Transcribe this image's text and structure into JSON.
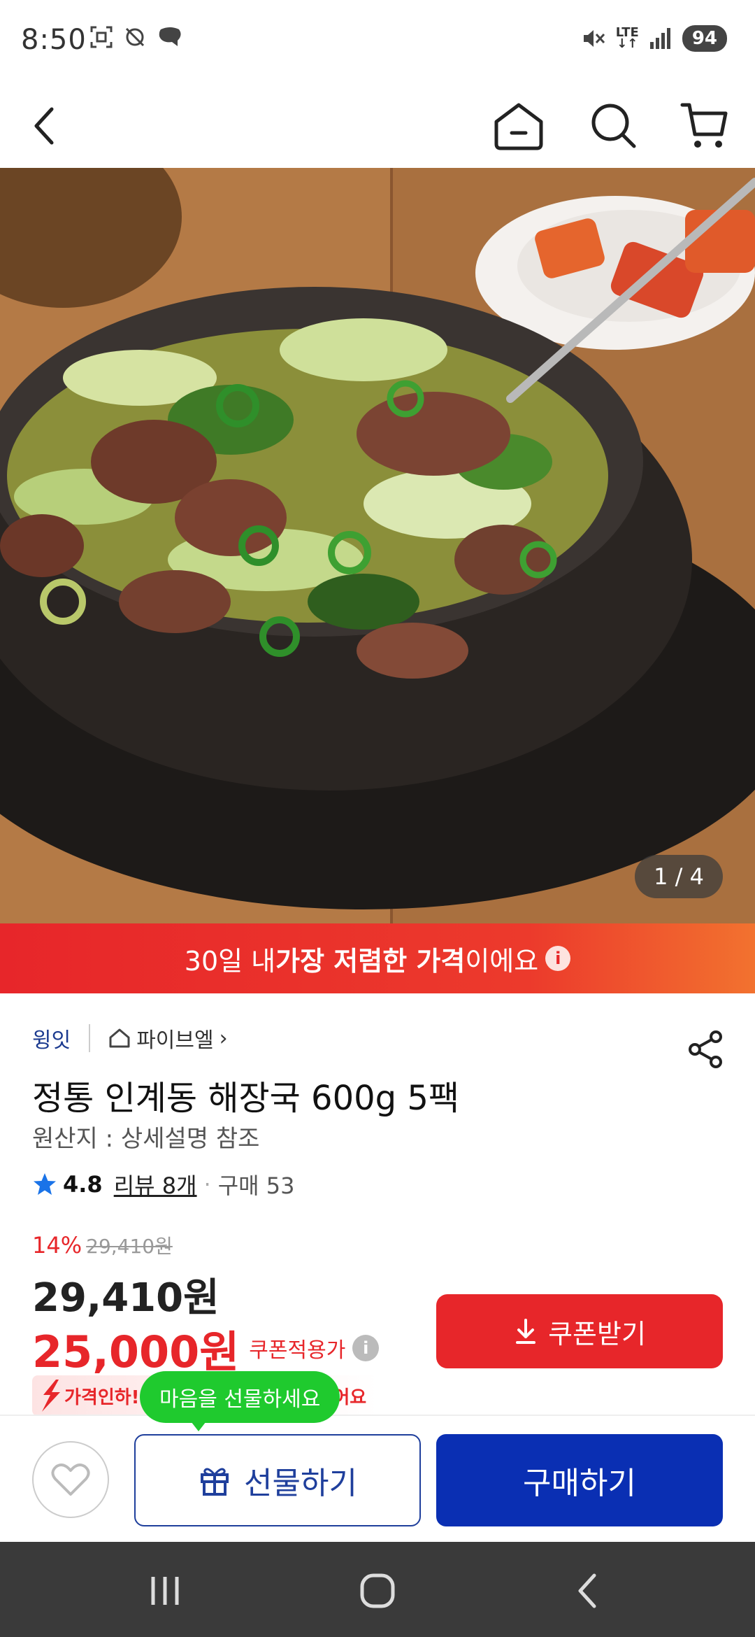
{
  "status_bar": {
    "time": "8:50",
    "network": "LTE",
    "battery": "94"
  },
  "nav": {
    "back_icon": "chevron-left-icon",
    "home_icon": "home-icon",
    "search_icon": "search-icon",
    "cart_icon": "cart-icon"
  },
  "hero": {
    "counter": "1 / 4"
  },
  "banner": {
    "prefix": "30일 내 ",
    "bold": "가장 저렴한 가격",
    "suffix": "이에요",
    "info": "i"
  },
  "product": {
    "brand": "윙잇",
    "store": "파이브엘",
    "store_chevron": "›",
    "title": "정통 인계동 해장국 600g 5팩",
    "origin": "원산지 : 상세설명 참조",
    "rating": "4.8",
    "reviews": "리뷰 8개",
    "purchases": "구매 53",
    "discount_rate": "14%",
    "original_price": "29,410원",
    "sale_price": "29,410원",
    "coupon_price": "25,000원",
    "coupon_label": "쿠폰적용가",
    "coupon_info": "i",
    "coupon_button": "쿠폰받기",
    "price_drop": "가격인하! 어제 3,660원 저렴해졌어요"
  },
  "actions": {
    "gift_bubble": "마음을 선물하세요",
    "gift_button": "선물하기",
    "buy_button": "구매하기"
  },
  "colors": {
    "accent_red": "#e7262a",
    "brand_blue": "#0a2fb3",
    "gift_green": "#1fca2e"
  }
}
